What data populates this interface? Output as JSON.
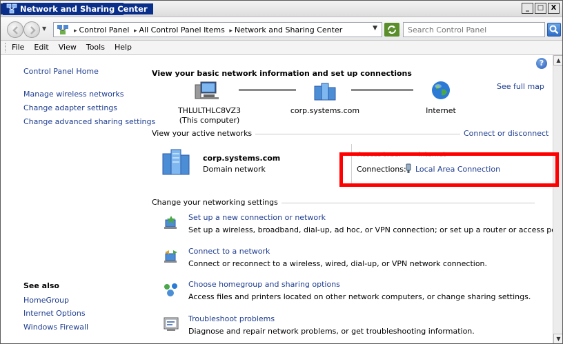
{
  "window": {
    "title": "Network and Sharing Center",
    "buttons": [
      "_",
      "□",
      "X"
    ]
  },
  "address_bar": {
    "breadcrumbs": [
      "Control Panel",
      "All Control Panel Items",
      "Network and Sharing Center"
    ],
    "search_placeholder": "Search Control Panel"
  },
  "menu": [
    "File",
    "Edit",
    "View",
    "Tools",
    "Help"
  ],
  "sidebar": {
    "links": [
      "Control Panel Home",
      "Manage wireless networks",
      "Change adapter settings",
      "Change advanced sharing settings"
    ],
    "see_also_heading": "See also",
    "see_also": [
      "HomeGroup",
      "Internet Options",
      "Windows Firewall"
    ]
  },
  "main": {
    "heading": "View your basic network information and set up connections",
    "see_full_map": "See full map",
    "map": {
      "computer": "THLULTHLC8VZ3",
      "computer_sub": "(This computer)",
      "network": "corp.systems.com",
      "internet": "Internet"
    },
    "active_networks": {
      "label": "View your active networks",
      "connect_link": "Connect or disconnect",
      "network_name": "corp.systems.com",
      "network_type": "Domain network",
      "access_type_label": "Access type:",
      "access_type_value": "Internet",
      "connections_label": "Connections:",
      "connection_name": "Local Area Connection"
    },
    "change_settings": {
      "label": "Change your networking settings",
      "tasks": [
        {
          "title": "Set up a new connection or network",
          "desc": "Set up a wireless, broadband, dial-up, ad hoc, or VPN connection; or set up a router or access point."
        },
        {
          "title": "Connect to a network",
          "desc": "Connect or reconnect to a wireless, wired, dial-up, or VPN network connection."
        },
        {
          "title": "Choose homegroup and sharing options",
          "desc": "Access files and printers located on other network computers, or change sharing settings."
        },
        {
          "title": "Troubleshoot problems",
          "desc": "Diagnose and repair network problems, or get troubleshooting information."
        }
      ]
    }
  },
  "colors": {
    "link": "#1e3d8f",
    "highlight": "#ff0000",
    "titlebar": "#0a3294"
  }
}
